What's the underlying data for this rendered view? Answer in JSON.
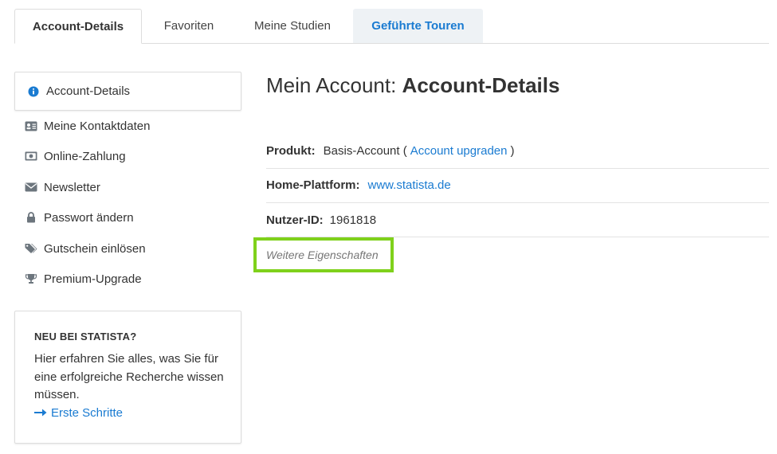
{
  "tabs": [
    {
      "label": "Account-Details"
    },
    {
      "label": "Favoriten"
    },
    {
      "label": "Meine Studien"
    },
    {
      "label": "Geführte Touren"
    }
  ],
  "sidebar": {
    "active": {
      "label": "Account-Details",
      "icon": "info-circle-icon"
    },
    "items": [
      {
        "label": "Meine Kontaktdaten",
        "icon": "id-card-icon"
      },
      {
        "label": "Online-Zahlung",
        "icon": "money-icon"
      },
      {
        "label": "Newsletter",
        "icon": "envelope-icon"
      },
      {
        "label": "Passwort ändern",
        "icon": "lock-icon"
      },
      {
        "label": "Gutschein einlösen",
        "icon": "tags-icon"
      },
      {
        "label": "Premium-Upgrade",
        "icon": "trophy-icon"
      }
    ]
  },
  "infobox": {
    "title": "NEU BEI STATISTA?",
    "text": "Hier erfahren Sie alles, was Sie für eine erfolgreiche Recherche wissen müssen.",
    "link": "Erste Schritte"
  },
  "main": {
    "title_prefix": "Mein Account: ",
    "title_bold": "Account-Details",
    "product_label": "Produkt:",
    "product_value": "Basis-Account (",
    "product_link": "Account upgraden",
    "product_close": ")",
    "platform_label": "Home-Plattform:",
    "platform_link": "www.statista.de",
    "userid_label": "Nutzer-ID:",
    "userid_value": "1961818",
    "more_label": "Weitere Eigenschaften"
  },
  "colors": {
    "accent": "#1a7bd1",
    "highlight_border": "#7fd11b",
    "tab_highlight_bg": "#eef2f5",
    "icon_gray": "#6c757d"
  }
}
